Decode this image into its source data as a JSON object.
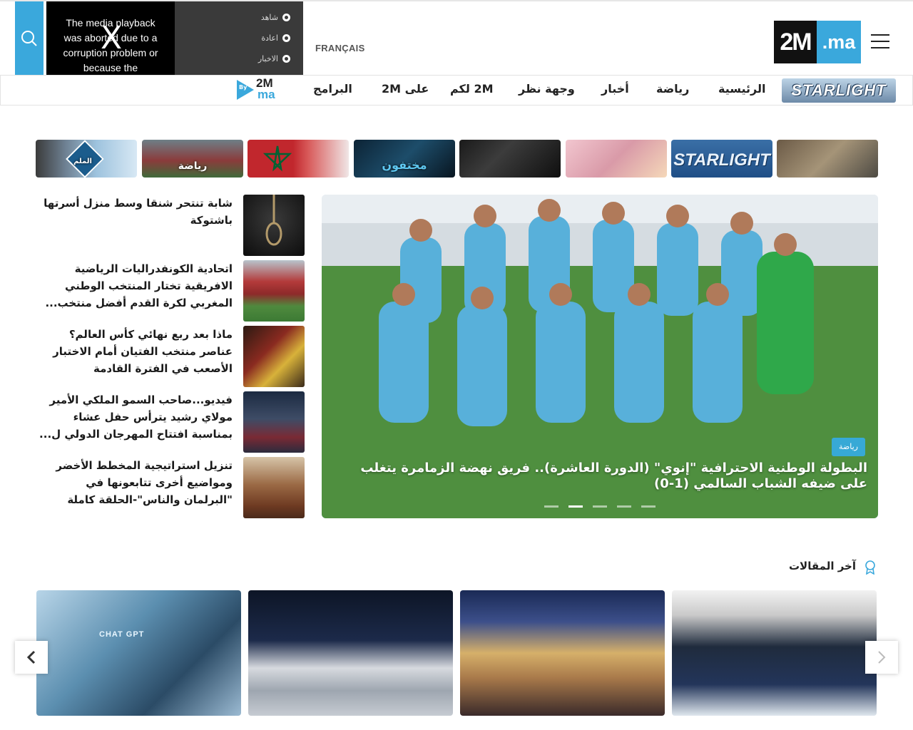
{
  "header": {
    "player_message": "The media playback was aborted due to a corruption problem or because the",
    "player_close": "X",
    "quick_links": [
      "شاهد",
      "اعادة",
      "الاخبار"
    ],
    "language": "FRANÇAIS",
    "logo": {
      "part1": "2M",
      "part2": ".ma"
    },
    "brand_color": "#3aa8dc"
  },
  "nav": {
    "starlight": "STARLIGHT",
    "items": [
      "الرئيسية",
      "رياضة",
      "أخبار",
      "وجهة نظر",
      "2M لكم",
      "على 2M",
      "البرامج"
    ],
    "by2m": {
      "by": "By",
      "m": "2M",
      "ma": "ma"
    }
  },
  "strip": [
    {
      "label": ""
    },
    {
      "label": "STARLIGHT"
    },
    {
      "label": ""
    },
    {
      "label": ""
    },
    {
      "label": "مختفون"
    },
    {
      "label": ""
    },
    {
      "label": "رياضة"
    },
    {
      "label": "الملم"
    }
  ],
  "side_news": [
    {
      "title": "شابة تنتحر شنقا وسط منزل أسرتها باشتوكة"
    },
    {
      "title": "اتحادية الكونفدراليات الرياضية الافريقية تختار المنتخب الوطني المغربي لكرة القدم أفضل منتخب..."
    },
    {
      "title": "ماذا بعد ربع نهائي كأس العالم؟ عناصر منتخب الفتيان أمام الاختبار الأصعب في الفترة القادمة"
    },
    {
      "title": "فيديو...صاحب السمو الملكي الأمير مولاي رشيد يترأس حفل عشاء بمناسبة افتتاح المهرجان الدولي ل..."
    },
    {
      "title": "تنزيل استراتيجية المخطط الأخضر ومواضيع أخرى تتابعونها في \"البرلمان والناس\"-الحلقة كاملة"
    }
  ],
  "hero": {
    "category": "رياضة",
    "title": "البطولة الوطنية الاحترافية \"إنوي\" (الدورة العاشرة).. فريق نهضة الزمامرة يتغلب على ضيفه الشباب السالمي (1-0)",
    "slides": 5,
    "active_slide": 2
  },
  "latest": {
    "title": "آخر المقالات",
    "cards": [
      {
        "label": ""
      },
      {
        "label": ""
      },
      {
        "label": ""
      },
      {
        "label": "CHAT GPT"
      }
    ]
  }
}
